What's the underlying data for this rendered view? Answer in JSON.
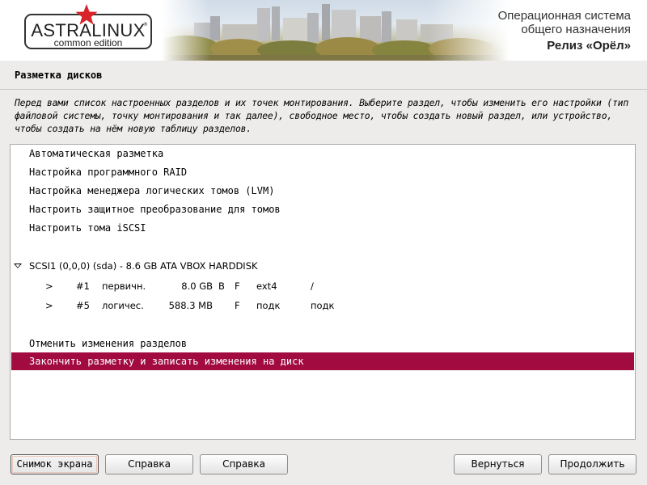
{
  "header": {
    "logo_text": "ASTRALINUX",
    "logo_reg": "®",
    "logo_sub": "common edition",
    "os_line1": "Операционная система",
    "os_line2": "общего назначения",
    "release": "Релиз «Орёл»",
    "star_color": "#d8232a"
  },
  "page": {
    "title": "Разметка дисков",
    "description": "Перед вами список настроенных разделов и их точек монтирования. Выберите раздел, чтобы изменить его настройки (тип файловой системы, точку монтирования и так далее), свободное место, чтобы создать новый раздел, или устройство, чтобы создать на нём новую таблицу разделов."
  },
  "list": {
    "items": [
      {
        "label": "Автоматическая разметка"
      },
      {
        "label": "Настройка программного RAID"
      },
      {
        "label": "Настройка менеджера логических томов (LVM)"
      },
      {
        "label": "Настроить защитное преобразование для томов"
      },
      {
        "label": "Настроить тома iSCSI"
      }
    ],
    "disk": {
      "label": "SCSI1 (0,0,0) (sda) - 8.6 GB ATA VBOX HARDDISK"
    },
    "partitions": [
      {
        "arrow": ">",
        "num": "#1",
        "type": "первичн.",
        "size": "8.0 GB",
        "bootable": "B",
        "format": "F",
        "fs": "ext4",
        "mount": "/"
      },
      {
        "arrow": ">",
        "num": "#5",
        "type": "логичес.",
        "size": "588.3 MB",
        "bootable": "",
        "format": "F",
        "fs": "подк",
        "mount": "подк"
      }
    ],
    "undo": {
      "label": "Отменить изменения разделов"
    },
    "finish": {
      "label": "Закончить разметку и записать изменения на диск"
    },
    "selected_color": "#a10b3f"
  },
  "buttons": {
    "screenshot": "Снимок экрана",
    "help1": "Справка",
    "help2": "Справка",
    "back": "Вернуться",
    "continue": "Продолжить"
  }
}
